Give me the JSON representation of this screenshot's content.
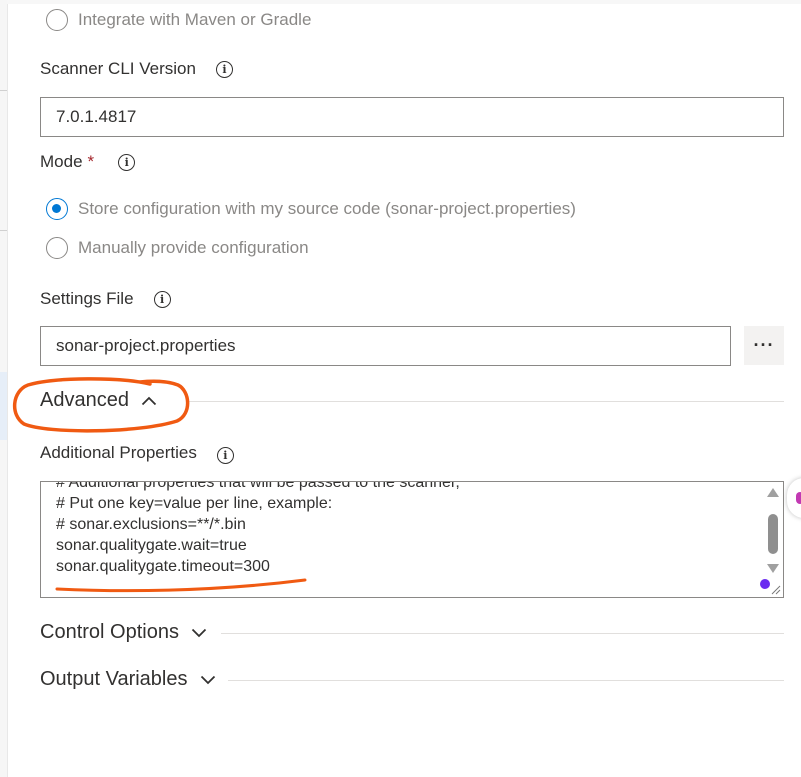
{
  "integration": {
    "maven_gradle_label": "Integrate with Maven or Gradle"
  },
  "scanner_cli": {
    "label": "Scanner CLI Version",
    "value": "7.0.1.4817"
  },
  "mode": {
    "label": "Mode",
    "required_marker": "*",
    "options": [
      {
        "label": "Store configuration with my source code (sonar-project.properties)",
        "selected": true
      },
      {
        "label": "Manually provide configuration",
        "selected": false
      }
    ]
  },
  "settings_file": {
    "label": "Settings File",
    "value": "sonar-project.properties",
    "browse_label": "···"
  },
  "advanced": {
    "title": "Advanced",
    "expanded": true
  },
  "additional_properties": {
    "label": "Additional Properties",
    "lines": [
      "# Additional properties that will be passed to the scanner,",
      "# Put one key=value per line, example:",
      "# sonar.exclusions=**/*.bin",
      "sonar.qualitygate.wait=true",
      "sonar.qualitygate.timeout=300"
    ]
  },
  "control_options": {
    "title": "Control Options",
    "expanded": false
  },
  "output_variables": {
    "title": "Output Variables",
    "expanded": false
  },
  "colors": {
    "accent": "#0078d4",
    "annotation": "#f05a12",
    "required": "#a4262c"
  },
  "icons": [
    "info-icon",
    "chevron-up-icon",
    "chevron-down-icon",
    "ellipsis-icon"
  ]
}
